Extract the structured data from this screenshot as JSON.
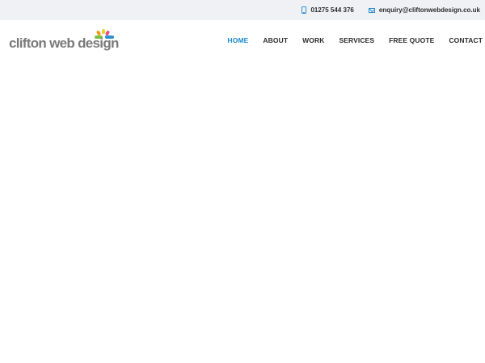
{
  "topbar": {
    "phone": "01275 544 376",
    "email": "enquiry@cliftonwebdesign.co.uk"
  },
  "logo": {
    "text": "clifton web design",
    "mark_colors": [
      "#2f8fd1",
      "#7cc242",
      "#f39a1e",
      "#e84e8a",
      "#f5d01e"
    ]
  },
  "nav": {
    "items": [
      {
        "label": "HOME",
        "active": true
      },
      {
        "label": "ABOUT",
        "active": false
      },
      {
        "label": "WORK",
        "active": false
      },
      {
        "label": "SERVICES",
        "active": false
      },
      {
        "label": "FREE QUOTE",
        "active": false
      },
      {
        "label": "CONTACT",
        "active": false
      }
    ]
  },
  "colors": {
    "topbar_bg": "#eff1f4",
    "accent": "#1a8ad0",
    "text": "#2b2b2b",
    "logo_text": "#7a7a7a"
  }
}
